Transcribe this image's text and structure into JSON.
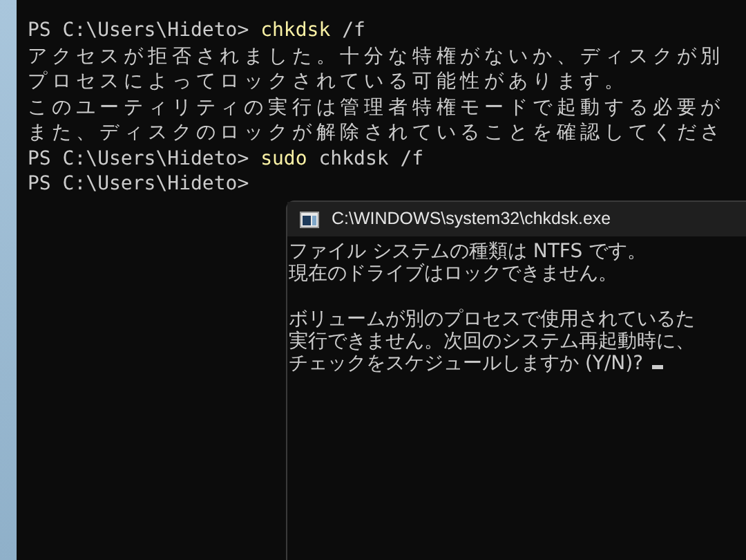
{
  "terminal": {
    "lines": [
      {
        "parts": [
          {
            "kind": "plain",
            "text": "PS C:\\Users\\Hideto> "
          },
          {
            "kind": "command",
            "text": "chkdsk"
          },
          {
            "kind": "plain",
            "text": " /f"
          }
        ]
      },
      {
        "parts": [
          {
            "kind": "plain",
            "text": "アクセスが拒否されました。十分な特権がないか、ディスクが別"
          }
        ]
      },
      {
        "parts": [
          {
            "kind": "plain",
            "text": "プロセスによってロックされている可能性があります。"
          }
        ]
      },
      {
        "parts": [
          {
            "kind": "plain",
            "text": "このユーティリティの実行は管理者特権モードで起動する必要が"
          }
        ]
      },
      {
        "parts": [
          {
            "kind": "plain",
            "text": "また、ディスクのロックが解除されていることを確認してくださ"
          }
        ]
      },
      {
        "parts": [
          {
            "kind": "plain",
            "text": "PS C:\\Users\\Hideto> "
          },
          {
            "kind": "command",
            "text": "sudo"
          },
          {
            "kind": "plain",
            "text": " chkdsk /f"
          }
        ]
      },
      {
        "parts": [
          {
            "kind": "plain",
            "text": "PS C:\\Users\\Hideto>"
          }
        ]
      }
    ]
  },
  "console_window": {
    "title": "C:\\WINDOWS\\system32\\chkdsk.exe",
    "paragraphs": [
      [
        "ファイル システムの種類は NTFS です。",
        "現在のドライブはロックできません。"
      ],
      [
        "ボリュームが別のプロセスで使用されているた",
        "実行できません。次回のシステム再起動時に、",
        "チェックをスケジュールしますか (Y/N)?"
      ]
    ]
  }
}
